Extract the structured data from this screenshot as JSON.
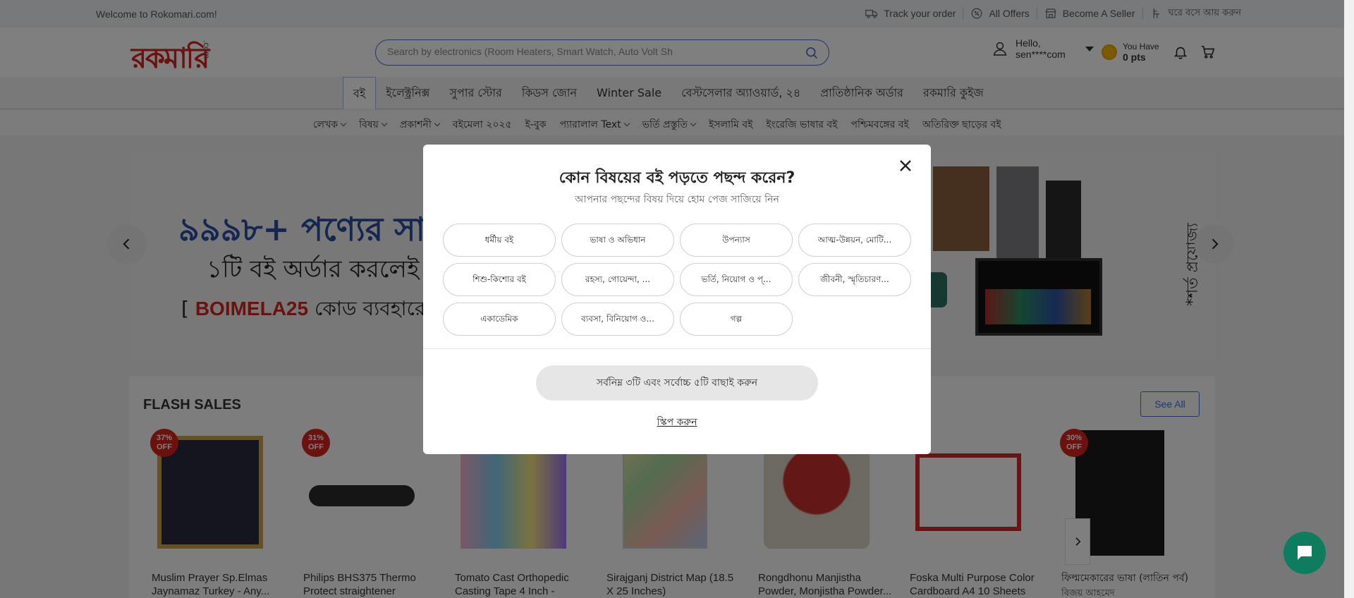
{
  "topbar": {
    "welcome": "Welcome to Rokomari.com!",
    "track_order": "Track your order",
    "all_offers": "All Offers",
    "become_seller": "Become A Seller",
    "earn_home": "ঘরে বসে আয় করুন"
  },
  "header": {
    "logo": "রকমারি",
    "logo_com": ".com",
    "search_placeholder": "Search by electronics (Room Heaters, Smart Watch, Auto Volt Sh",
    "greeting": "Hello,",
    "username": "sen****com",
    "points_label": "You Have",
    "points_value": "0 pts"
  },
  "catnav": [
    "বই",
    "ইলেক্ট্রনিক্স",
    "সুপার স্টোর",
    "কিডস জোন",
    "Winter Sale",
    "বেস্টসেলার অ্যাওয়ার্ড, ২৪",
    "প্রাতিষ্ঠানিক অর্ডার",
    "রকমারি কুইজ"
  ],
  "subnav": [
    {
      "label": "লেখক",
      "dropdown": true
    },
    {
      "label": "বিষয়",
      "dropdown": true
    },
    {
      "label": "প্রকাশনী",
      "dropdown": true
    },
    {
      "label": "বইমেলা ২০২৫",
      "dropdown": false
    },
    {
      "label": "ই-বুক",
      "dropdown": false
    },
    {
      "label": "প্যারালাল Text",
      "dropdown": true
    },
    {
      "label": "ভর্তি প্রস্তুতি",
      "dropdown": true
    },
    {
      "label": "ইসলামি বই",
      "dropdown": false
    },
    {
      "label": "ইংরেজি ভাষার বই",
      "dropdown": false
    },
    {
      "label": "পশ্চিমবঙ্গের বই",
      "dropdown": false
    },
    {
      "label": "অতিরিক্ত ছাড়ের বই",
      "dropdown": false
    }
  ],
  "banner": {
    "line1": "৯৯৯৮+ পণ্যের সা",
    "line2": "১টি বই অর্ডার করলেই",
    "line3_prefix": "[ ",
    "line3_code": "BOIMELA25",
    "line3_suffix": " কোড ব্যবহারে",
    "side_text": "*শর্ত প্রযোজ্য"
  },
  "flash": {
    "title": "FLASH SALES",
    "see_all": "See All",
    "products": [
      {
        "name": "Muslim Prayer Sp.Elmas",
        "name2": "Jaynamaz Turkey - Any...",
        "discount": "37%",
        "off": "OFF"
      },
      {
        "name": "Philips BHS375 Thermo",
        "name2": "Protect straightener",
        "discount": "31%",
        "off": "OFF"
      },
      {
        "name": "Tomato Cast Orthopedic",
        "name2": "Casting Tape 4 Inch -",
        "discount": "",
        "off": ""
      },
      {
        "name": "Sirajganj District Map (18.5",
        "name2": "X 25 Inches)",
        "discount": "",
        "off": ""
      },
      {
        "name": "Rongdhonu Manjistha",
        "name2": "Powder, Monjistha Powder...",
        "discount": "",
        "off": ""
      },
      {
        "name": "Foska Multi Purpose Color",
        "name2": "Cardboard A4 10 Sheets",
        "discount": "",
        "off": ""
      },
      {
        "name": "ফিল্মমেকারের ভাষা (লাতিন পর্ব)",
        "name2": "বিজয় আহমেদ",
        "discount": "30%",
        "off": "OFF"
      }
    ]
  },
  "modal": {
    "title": "কোন বিষয়ের বই পড়তে পছন্দ করেন?",
    "subtitle": "আপনার পছন্দের বিষয় দিয়ে হোম পেজ সাজিয়ে নিন",
    "chips": [
      "ধর্মীয় বই",
      "ভাষা ও অভিধান",
      "উপন্যাস",
      "আত্ম-উন্নয়ন, মোটি...",
      "শিশু-কিশোর বই",
      "রহস্য, গোয়েন্দা, ...",
      "ভর্তি, নিয়োগ ও প্...",
      "জীবনী, স্মৃতিচারণ...",
      "একাডেমিক",
      "ব্যবসা, বিনিয়োগ ও...",
      "গল্প"
    ],
    "submit": "সর্বনিম্ন ৩টি এবং সর্বোচ্চ ৫টি বাছাই করুন",
    "skip": "স্কিপ করুন"
  }
}
